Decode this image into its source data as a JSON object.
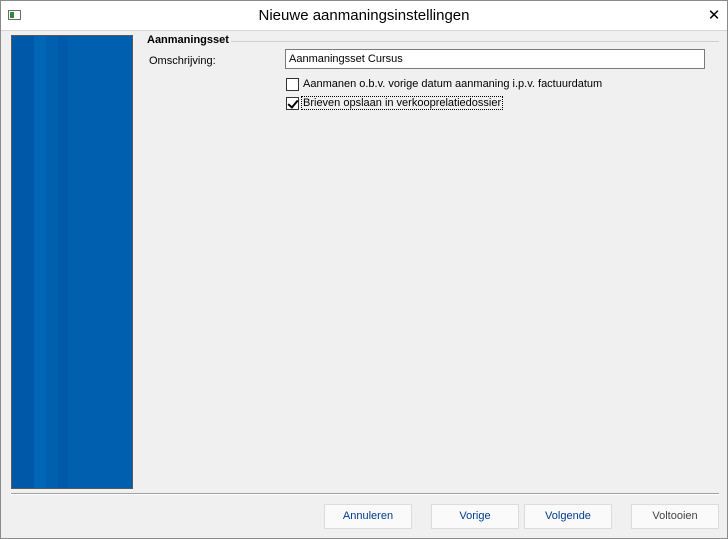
{
  "window": {
    "title": "Nieuwe aanmaningsinstellingen",
    "close_glyph": "✕"
  },
  "section": {
    "title": "Aanmaningsset"
  },
  "fields": {
    "description_label": "Omschrijving:",
    "description_value": "Aanmaningsset Cursus"
  },
  "options": [
    {
      "label": "Aanmanen o.b.v. vorige datum aanmaning i.p.v. factuurdatum",
      "checked": false
    },
    {
      "label": "Brieven opslaan in verkooprelatiedossier",
      "checked": true
    }
  ],
  "buttons": {
    "cancel": "Annuleren",
    "previous": "Vorige",
    "next": "Volgende",
    "finish": "Voltooien"
  },
  "colors": {
    "side_panel": "#0060b0",
    "button_text": "#003c8c"
  },
  "icons": {
    "app": "window-app-icon",
    "close": "close-icon"
  }
}
